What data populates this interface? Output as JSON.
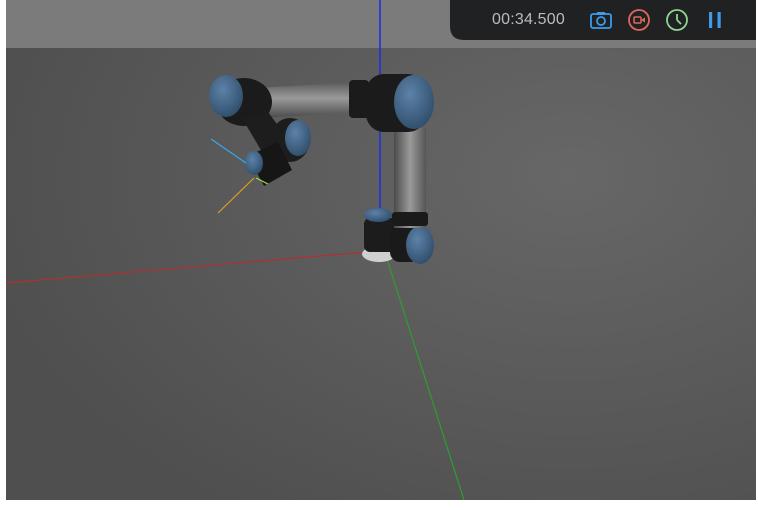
{
  "toolbar": {
    "time": "00:34.500",
    "buttons": [
      {
        "name": "screenshot",
        "icon": "camera-icon",
        "color": "#3d9be9"
      },
      {
        "name": "record",
        "icon": "video-record-icon",
        "color": "#e0685a"
      },
      {
        "name": "speed",
        "icon": "clock-icon",
        "color": "#8fd48f"
      },
      {
        "name": "pause",
        "icon": "pause-icon",
        "color": "#3d9be9"
      }
    ]
  },
  "scene": {
    "background": "#555555",
    "axes": {
      "x_color": "#b03030",
      "y_color": "#2e9e2e",
      "z_color": "#2030e0"
    },
    "robot": {
      "link_color": "#7a7a7a",
      "joint_color": "#1a1a1a",
      "cap_color": "#3a5f80"
    }
  }
}
